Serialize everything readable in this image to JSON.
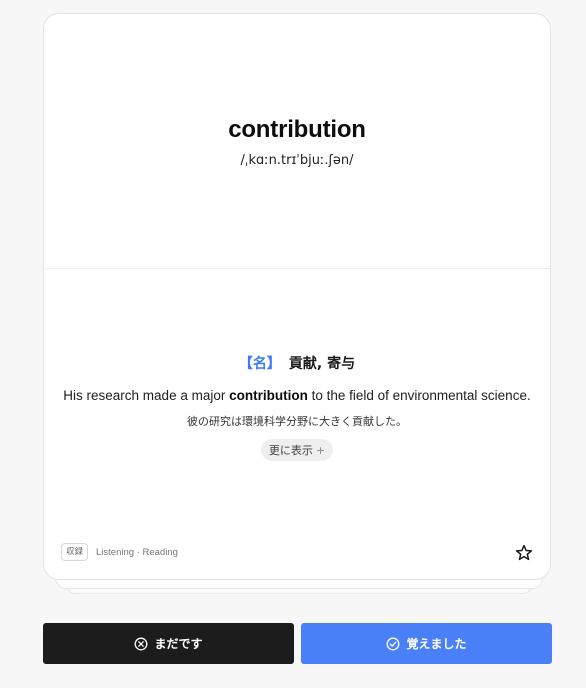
{
  "card": {
    "word": "contribution",
    "ipa": "/ˌkɑːn.trɪˈbjuː.ʃən/",
    "part_of_speech": "【名】",
    "meaning": "貢献, 寄与",
    "example": {
      "before": "His research made a major ",
      "highlight": "contribution",
      "after": " to the field of environmental science."
    },
    "translation": "彼の研究は環境科学分野に大きく貢献した。",
    "show_more_label": "更に表示",
    "show_more_icon": "+",
    "badge": "収録",
    "tags": "Listening · Reading"
  },
  "actions": {
    "not_yet_label": "まだです",
    "learned_label": "覚えました"
  },
  "colors": {
    "accent": "#4a80f7",
    "dark_button": "#1c1c1c",
    "pos_color": "#3b7cf6"
  }
}
